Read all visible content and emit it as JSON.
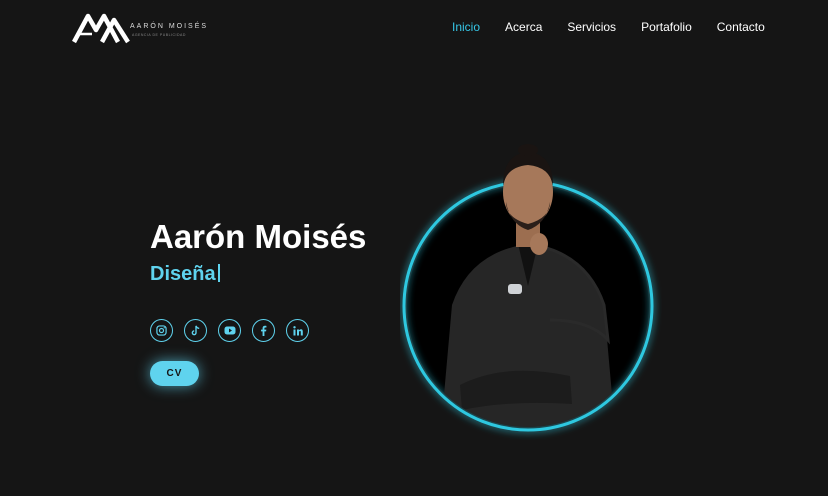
{
  "brand": {
    "name": "AARÓN MOISÉS",
    "subtitle": "AGENCIA DE PUBLICIDAD"
  },
  "nav": {
    "items": [
      {
        "label": "Inicio",
        "active": true
      },
      {
        "label": "Acerca",
        "active": false
      },
      {
        "label": "Servicios",
        "active": false
      },
      {
        "label": "Portafolio",
        "active": false
      },
      {
        "label": "Contacto",
        "active": false
      }
    ]
  },
  "hero": {
    "name": "Aarón Moisés",
    "role_typed": "Diseña"
  },
  "socials": [
    "instagram-icon",
    "tiktok-icon",
    "youtube-icon",
    "facebook-icon",
    "linkedin-icon"
  ],
  "cv_button": {
    "label": "CV"
  },
  "colors": {
    "background": "#151515",
    "accent": "#5fd3ee",
    "nav_active": "#36c6e6"
  }
}
